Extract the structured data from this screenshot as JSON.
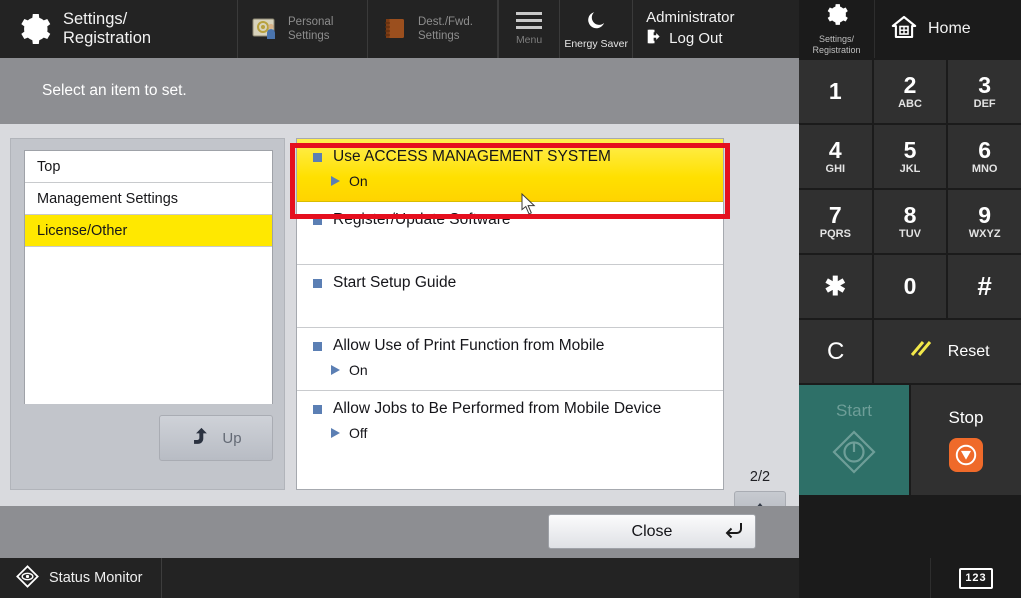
{
  "header": {
    "gear_icon": "gear-icon",
    "title": "Settings/\nRegistration",
    "tabs": [
      {
        "label": "Personal\nSettings",
        "icon": "personal-settings-icon"
      },
      {
        "label": "Dest./Fwd.\nSettings",
        "icon": "address-book-icon"
      }
    ],
    "menu": {
      "label": "Menu",
      "icon": "hamburger-icon"
    },
    "energy_saver": {
      "label": "Energy Saver",
      "icon": "moon-icon"
    },
    "user": {
      "name": "Administrator",
      "logout_label": "Log Out",
      "logout_icon": "log-out-icon"
    }
  },
  "instruction": {
    "text": "Select an item to set."
  },
  "sidebar": {
    "items": [
      {
        "label": "Top",
        "selected": false
      },
      {
        "label": "Management Settings",
        "selected": false
      },
      {
        "label": "License/Other",
        "selected": true
      }
    ],
    "up_button": {
      "label": "Up",
      "icon": "arrow-up-curved-icon"
    }
  },
  "list": {
    "rows": [
      {
        "title": "Use ACCESS MANAGEMENT SYSTEM",
        "value": "On",
        "highlighted": true
      },
      {
        "title": "Register/Update Software",
        "value": "",
        "highlighted": false
      },
      {
        "title": "Start Setup Guide",
        "value": "",
        "highlighted": false
      },
      {
        "title": "Allow Use of Print Function from Mobile",
        "value": "On",
        "highlighted": false
      },
      {
        "title": "Allow Jobs to Be Performed from Mobile Device",
        "value": "Off",
        "highlighted": false
      }
    ]
  },
  "pager": {
    "page_indicator": "2/2",
    "up_icon": "triangle-up-icon",
    "down_icon": "triangle-down-icon"
  },
  "footer": {
    "close_label": "Close",
    "close_icon": "return-arrow-icon"
  },
  "status_bar": {
    "label": "Status Monitor",
    "icon": "status-monitor-icon"
  },
  "hard_panel": {
    "settings_label": "Settings/\nRegistration",
    "home_label": "Home",
    "keys": [
      {
        "num": "1",
        "sub": ""
      },
      {
        "num": "2",
        "sub": "ABC"
      },
      {
        "num": "3",
        "sub": "DEF"
      },
      {
        "num": "4",
        "sub": "GHI"
      },
      {
        "num": "5",
        "sub": "JKL"
      },
      {
        "num": "6",
        "sub": "MNO"
      },
      {
        "num": "7",
        "sub": "PQRS"
      },
      {
        "num": "8",
        "sub": "TUV"
      },
      {
        "num": "9",
        "sub": "WXYZ"
      },
      {
        "num": "✱",
        "sub": ""
      },
      {
        "num": "0",
        "sub": ""
      },
      {
        "num": "#",
        "sub": ""
      }
    ],
    "clear_label": "C",
    "reset_label": "Reset",
    "start_label": "Start",
    "stop_label": "Stop",
    "numeric_keys_label": "123"
  },
  "colors": {
    "highlight_yellow": "#ffe000",
    "annotation_red": "#e50f1e",
    "accent_blue": "#5b7fb4",
    "start_green": "#2e7068",
    "stop_orange": "#ef6a2a"
  }
}
